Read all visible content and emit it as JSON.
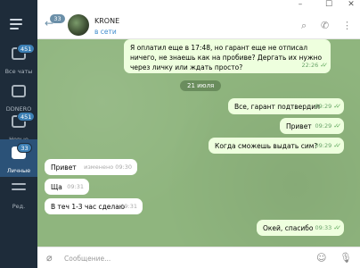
{
  "sidebar": {
    "folders": [
      {
        "label": "Все чаты",
        "badge": "451"
      },
      {
        "label": "DDNERO",
        "badge": ""
      },
      {
        "label": "Новые",
        "badge": "451"
      },
      {
        "label": "Личные",
        "badge": "33"
      },
      {
        "label": "Ред.",
        "badge": ""
      }
    ]
  },
  "header": {
    "back_badge": "33",
    "title": "KRONE",
    "status": "в сети"
  },
  "messages": [
    {
      "text": "Я оплатил еще в 17:48, но гарант еще не отписал ничего, не знаешь как на пробиве? Дергать их нужно через личку или ждать просто?",
      "time": "22:26"
    },
    {
      "text": "Все, гарант подтвердил",
      "time": "09:29"
    },
    {
      "text": "Привет",
      "time": "09:29"
    },
    {
      "text": "Когда сможешь выдать сим?",
      "time": "09:29"
    },
    {
      "text": "Привет",
      "edited": "изменено",
      "time": "09:30"
    },
    {
      "text": "Ща",
      "time": "09:31"
    },
    {
      "text": "В теч 1-3 час сделаю",
      "time": "09:31"
    },
    {
      "text": "Окей, спасибо",
      "time": "09:33"
    }
  ],
  "date_separator": "21 июля",
  "composer": {
    "placeholder": "Сообщение..."
  },
  "icons": {
    "menu": "hamburger-icon",
    "folder": "folder-icon",
    "back": "back-arrow-icon",
    "search": "search-icon",
    "phone": "phone-icon",
    "more": "more-vertical-icon",
    "attach": "paperclip-icon",
    "emoji": "emoji-icon",
    "mic": "microphone-icon"
  },
  "colors": {
    "sidebar_bg": "#1e2c3a",
    "active_folder": "#2b5278",
    "outgoing_bubble": "#eeffde",
    "incoming_bubble": "#ffffff",
    "chat_bg": "#8fb57e",
    "accent": "#3d8bcd"
  }
}
